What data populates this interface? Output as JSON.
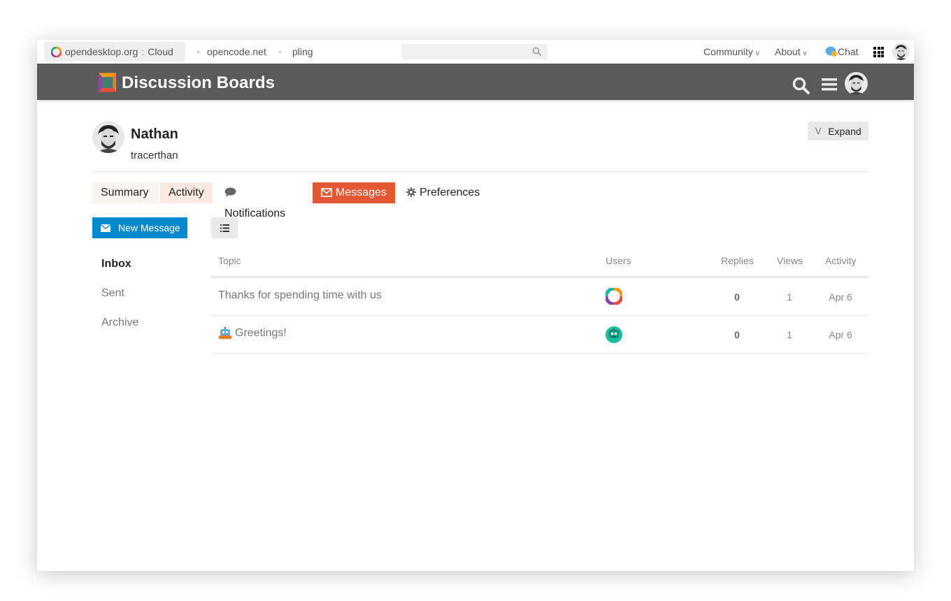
{
  "topbar": {
    "site_name": "opendesktop.org",
    "site_sep": ":",
    "site_sub": "Cloud",
    "links": [
      "opencode.net",
      "pling"
    ],
    "community": "Community",
    "about": "About",
    "chat": "Chat",
    "caret": "v"
  },
  "header": {
    "title": "Discussion Boards",
    "icons": [
      "search-icon",
      "hamburger-menu-icon",
      "avatar"
    ]
  },
  "user": {
    "name": "Nathan",
    "username": "tracerthan",
    "expand_label": "Expand"
  },
  "tabs": [
    {
      "label": "Summary"
    },
    {
      "label": "Activity"
    },
    {
      "label": "Notifications"
    },
    {
      "label": "Messages"
    },
    {
      "label": "Preferences"
    }
  ],
  "actions": {
    "new_message": "New Message"
  },
  "sidebar": {
    "items": [
      {
        "label": "Inbox"
      },
      {
        "label": "Sent"
      },
      {
        "label": "Archive"
      }
    ]
  },
  "table": {
    "headers": [
      "Topic",
      "Users",
      "Replies",
      "Views",
      "Activity"
    ],
    "rows": [
      {
        "topic": "Thanks for spending time with us",
        "replies": "0",
        "views": "1",
        "activity": "Apr 6"
      },
      {
        "topic": "Greetings!",
        "replies": "0",
        "views": "1",
        "activity": "Apr 6"
      }
    ]
  },
  "colors": {
    "header_bg": "#5a5a5a",
    "messages_tab": "#e45735",
    "activity_tab": "#fbe8e1",
    "primary_button": "#0088cc",
    "bot_avatar": "#1abc9c"
  }
}
